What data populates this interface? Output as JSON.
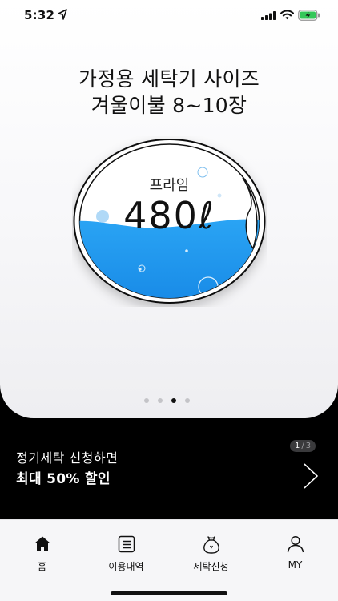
{
  "status_bar": {
    "time": "5:32",
    "icons": [
      "location-arrow-icon",
      "cellular-signal-icon",
      "wifi-icon",
      "battery-charging-icon"
    ],
    "battery_color": "#34c759"
  },
  "hero": {
    "title_line1": "가정용 세탁기 사이즈",
    "title_line2": "겨울이불 8~10장",
    "drum": {
      "label": "프라임",
      "size": "480ℓ",
      "water_color": "#1e9bf0"
    },
    "pager": {
      "count": 4,
      "active_index": 2
    }
  },
  "promo": {
    "subtitle": "정기세탁 신청하면",
    "headline": "최대 50% 할인",
    "counter_current": "1",
    "counter_separator": "/",
    "counter_total": "3",
    "next_icon": "chevron-right-icon"
  },
  "tabbar": {
    "tabs": [
      {
        "label": "홈",
        "icon": "home-icon"
      },
      {
        "label": "이용내역",
        "icon": "list-document-icon"
      },
      {
        "label": "세탁신청",
        "icon": "laundry-bag-icon"
      },
      {
        "label": "MY",
        "icon": "person-icon"
      }
    ]
  },
  "colors": {
    "accent_water": "#1e9bf0",
    "promo_background": "#000000",
    "text": "#111111"
  }
}
